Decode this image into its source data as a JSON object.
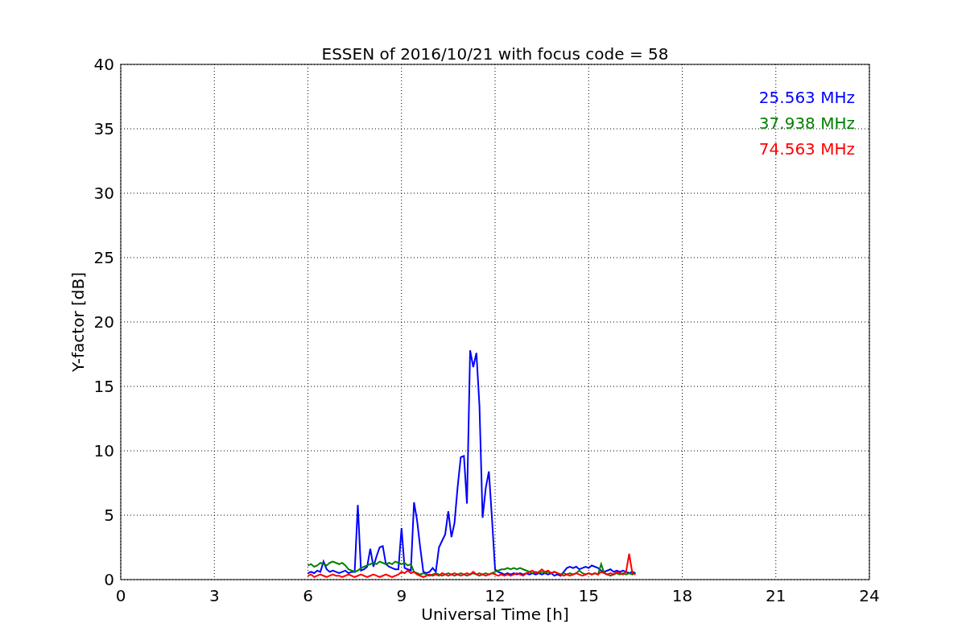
{
  "figure": {
    "chart_data": {
      "type": "line",
      "title": "ESSEN of 2016/10/21 with focus code = 58",
      "xlabel": "Universal Time [h]",
      "ylabel": "Y-factor [dB]",
      "xlim": [
        0,
        24
      ],
      "ylim": [
        0,
        40
      ],
      "xticks": [
        0,
        3,
        6,
        9,
        12,
        15,
        18,
        21,
        24
      ],
      "yticks": [
        0,
        5,
        10,
        15,
        20,
        25,
        30,
        35,
        40
      ],
      "grid": true,
      "x": [
        6,
        6.1,
        6.2,
        6.3,
        6.4,
        6.5,
        6.6,
        6.7,
        6.8,
        6.9,
        7,
        7.1,
        7.2,
        7.3,
        7.4,
        7.5,
        7.6,
        7.7,
        7.8,
        7.9,
        8,
        8.1,
        8.2,
        8.3,
        8.4,
        8.5,
        8.6,
        8.7,
        8.8,
        8.9,
        9,
        9.1,
        9.2,
        9.3,
        9.4,
        9.5,
        9.6,
        9.7,
        9.8,
        9.9,
        10,
        10.1,
        10.2,
        10.3,
        10.4,
        10.5,
        10.6,
        10.7,
        10.8,
        10.9,
        11,
        11.1,
        11.2,
        11.3,
        11.4,
        11.5,
        11.6,
        11.7,
        11.8,
        11.9,
        12,
        12.1,
        12.2,
        12.3,
        12.4,
        12.5,
        12.6,
        12.7,
        12.8,
        12.9,
        13,
        13.1,
        13.2,
        13.3,
        13.4,
        13.5,
        13.6,
        13.7,
        13.8,
        13.9,
        14,
        14.1,
        14.2,
        14.3,
        14.4,
        14.5,
        14.6,
        14.7,
        14.8,
        14.9,
        15,
        15.1,
        15.2,
        15.3,
        15.4,
        15.5,
        15.6,
        15.7,
        15.8,
        15.9,
        16,
        16.1,
        16.2,
        16.3,
        16.4,
        16.5
      ],
      "series": [
        {
          "name": "25.563 MHz",
          "color": "#0000ff",
          "values": [
            0.5,
            0.6,
            0.5,
            0.7,
            0.6,
            1.4,
            0.8,
            0.6,
            0.7,
            0.6,
            0.5,
            0.6,
            0.7,
            0.5,
            0.6,
            0.6,
            5.8,
            0.7,
            0.8,
            1.0,
            2.4,
            1.0,
            1.8,
            2.5,
            2.6,
            1.2,
            1.0,
            0.9,
            0.8,
            0.8,
            4.0,
            0.9,
            0.8,
            0.7,
            6.0,
            4.6,
            2.5,
            0.6,
            0.5,
            0.6,
            0.9,
            0.6,
            2.5,
            3.0,
            3.5,
            5.3,
            3.3,
            4.4,
            7.2,
            9.5,
            9.6,
            5.9,
            17.8,
            16.5,
            17.6,
            13.5,
            4.8,
            7.1,
            8.4,
            4.8,
            0.8,
            0.6,
            0.5,
            0.4,
            0.5,
            0.4,
            0.5,
            0.4,
            0.5,
            0.4,
            0.5,
            0.4,
            0.5,
            0.4,
            0.5,
            0.4,
            0.5,
            0.4,
            0.5,
            0.3,
            0.4,
            0.3,
            0.6,
            0.9,
            1.0,
            0.9,
            1.0,
            0.8,
            0.9,
            1.0,
            0.9,
            1.1,
            1.0,
            0.9,
            0.7,
            0.6,
            0.7,
            0.8,
            0.6,
            0.7,
            0.6,
            0.7,
            0.6,
            0.5,
            0.6,
            0.5
          ]
        },
        {
          "name": "37.938 MHz",
          "color": "#008000",
          "values": [
            1.1,
            1.2,
            1.0,
            1.1,
            1.3,
            1.2,
            1.1,
            1.3,
            1.4,
            1.3,
            1.2,
            1.3,
            1.1,
            0.8,
            0.7,
            0.6,
            0.7,
            0.9,
            1.0,
            1.1,
            1.2,
            1.3,
            1.2,
            1.4,
            1.3,
            1.2,
            1.3,
            1.2,
            1.4,
            1.3,
            1.2,
            1.3,
            1.1,
            1.2,
            0.6,
            0.5,
            0.4,
            0.5,
            0.4,
            0.3,
            0.4,
            0.5,
            0.4,
            0.3,
            0.4,
            0.5,
            0.4,
            0.3,
            0.4,
            0.5,
            0.4,
            0.3,
            0.4,
            0.5,
            0.4,
            0.3,
            0.4,
            0.5,
            0.4,
            0.5,
            0.6,
            0.7,
            0.8,
            0.8,
            0.9,
            0.8,
            0.9,
            0.8,
            0.9,
            0.8,
            0.7,
            0.6,
            0.5,
            0.6,
            0.5,
            0.6,
            0.5,
            0.6,
            0.5,
            0.6,
            0.5,
            0.4,
            0.5,
            0.4,
            0.5,
            0.4,
            0.5,
            0.7,
            0.5,
            0.4,
            0.5,
            0.4,
            0.5,
            0.4,
            1.2,
            0.5,
            0.4,
            0.3,
            0.4,
            0.5,
            0.4,
            0.5,
            0.4,
            0.5,
            0.4,
            0.5
          ]
        },
        {
          "name": "74.563 MHz",
          "color": "#ff0000",
          "values": [
            0.3,
            0.4,
            0.2,
            0.3,
            0.4,
            0.3,
            0.2,
            0.3,
            0.4,
            0.3,
            0.3,
            0.2,
            0.3,
            0.4,
            0.3,
            0.2,
            0.3,
            0.4,
            0.3,
            0.2,
            0.3,
            0.4,
            0.3,
            0.2,
            0.3,
            0.4,
            0.3,
            0.2,
            0.3,
            0.4,
            0.6,
            0.5,
            0.7,
            0.5,
            0.6,
            0.4,
            0.3,
            0.2,
            0.3,
            0.4,
            0.3,
            0.4,
            0.3,
            0.5,
            0.4,
            0.3,
            0.4,
            0.5,
            0.4,
            0.3,
            0.4,
            0.5,
            0.4,
            0.6,
            0.4,
            0.5,
            0.4,
            0.3,
            0.4,
            0.5,
            0.4,
            0.3,
            0.4,
            0.3,
            0.4,
            0.3,
            0.4,
            0.5,
            0.4,
            0.3,
            0.5,
            0.6,
            0.7,
            0.5,
            0.6,
            0.8,
            0.6,
            0.7,
            0.5,
            0.6,
            0.5,
            0.4,
            0.3,
            0.4,
            0.3,
            0.4,
            0.5,
            0.4,
            0.3,
            0.4,
            0.5,
            0.4,
            0.5,
            0.4,
            0.6,
            0.5,
            0.4,
            0.5,
            0.4,
            0.6,
            0.5,
            0.4,
            0.6,
            2.0,
            0.5,
            0.4
          ]
        }
      ]
    }
  }
}
